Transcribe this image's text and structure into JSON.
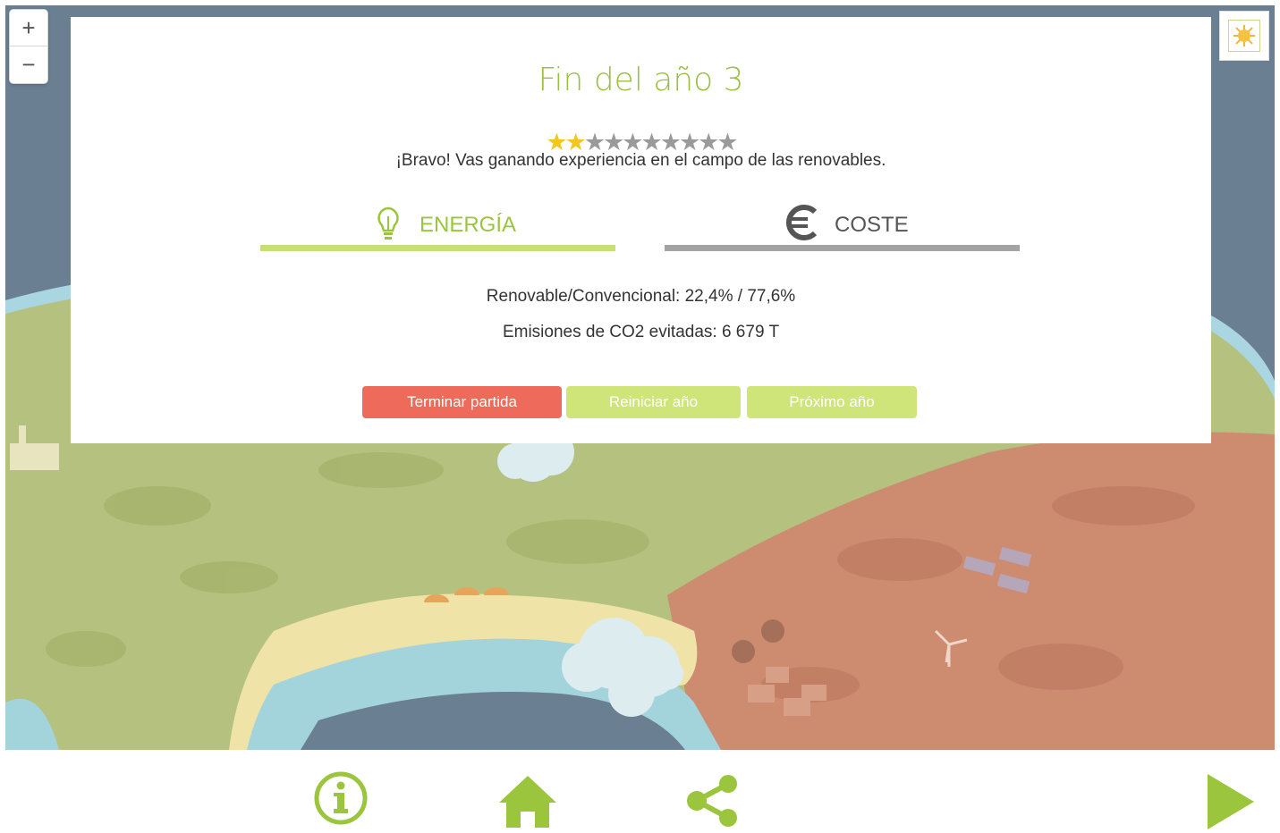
{
  "zoom": {
    "in_label": "+",
    "out_label": "−"
  },
  "dialog": {
    "title": "Fin del año 3",
    "rating": {
      "filled": 2,
      "total": 10
    },
    "message": "¡Bravo! Vas ganando experiencia en el campo de las renovables.",
    "tabs": [
      {
        "label": "ENERGÍA",
        "icon": "lightbulb-icon",
        "active": true
      },
      {
        "label": "COSTE",
        "icon": "euro-icon",
        "active": false
      }
    ],
    "stats": {
      "renewable": "Renovable/Convencional: 22,4% / 77,6%",
      "co2": "Emisiones de CO2 evitadas: 6 679 T"
    },
    "buttons": {
      "end": "Terminar partida",
      "restart": "Reiniciar año",
      "next": "Próximo año"
    }
  },
  "bottom_nav": {
    "icons": [
      "info-icon",
      "home-icon",
      "share-icon",
      "play-icon"
    ]
  },
  "colors": {
    "accent_green": "#9bc53d",
    "button_red": "#ee6a5b",
    "button_green": "#cfe57a",
    "tab_inactive": "#a3a3a3",
    "map_water": "#6a7f92",
    "land_green": "#b7c27a",
    "land_red": "#cd8a6e"
  }
}
